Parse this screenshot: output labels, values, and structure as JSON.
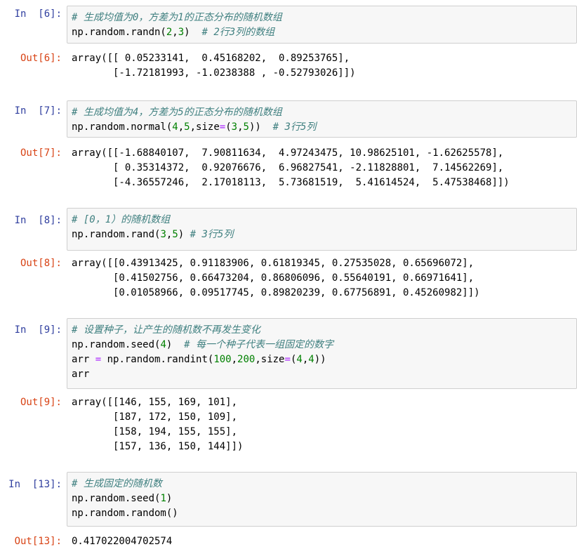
{
  "cells": [
    {
      "in_prompt": "In  [6]:",
      "code": [
        [
          {
            "t": "# 生成均值为0，方差为1的正态分布的随机数组",
            "c": "comment"
          }
        ],
        [
          {
            "t": "np.random.randn(",
            "c": ""
          },
          {
            "t": "2",
            "c": "num"
          },
          {
            "t": ",",
            "c": ""
          },
          {
            "t": "3",
            "c": "num"
          },
          {
            "t": ")  ",
            "c": ""
          },
          {
            "t": "# 2行3列的数组",
            "c": "comment"
          }
        ]
      ],
      "out_prompt": "Out[6]:",
      "output": [
        "array([[ 0.05233141,  0.45168202,  0.89253765],",
        "       [-1.72181993, -1.0238388 , -0.52793026]])"
      ]
    },
    {
      "in_prompt": "In  [7]:",
      "code": [
        [
          {
            "t": "# 生成均值为4，方差为5的正态分布的随机数组",
            "c": "comment"
          }
        ],
        [
          {
            "t": "np.random.normal(",
            "c": ""
          },
          {
            "t": "4",
            "c": "num"
          },
          {
            "t": ",",
            "c": ""
          },
          {
            "t": "5",
            "c": "num"
          },
          {
            "t": ",size",
            "c": ""
          },
          {
            "t": "=",
            "c": "op"
          },
          {
            "t": "(",
            "c": ""
          },
          {
            "t": "3",
            "c": "num"
          },
          {
            "t": ",",
            "c": ""
          },
          {
            "t": "5",
            "c": "num"
          },
          {
            "t": "))  ",
            "c": ""
          },
          {
            "t": "# 3行5列",
            "c": "comment"
          }
        ]
      ],
      "out_prompt": "Out[7]:",
      "output": [
        "array([[-1.68840107,  7.90811634,  4.97243475, 10.98625101, -1.62625578],",
        "       [ 0.35314372,  0.92076676,  6.96827541, -2.11828801,  7.14562269],",
        "       [-4.36557246,  2.17018113,  5.73681519,  5.41614524,  5.47538468]])"
      ]
    },
    {
      "in_prompt": "In  [8]:",
      "code": [
        [
          {
            "t": "# [0，1）的随机数组",
            "c": "comment"
          }
        ],
        [
          {
            "t": "np.random.rand(",
            "c": ""
          },
          {
            "t": "3",
            "c": "num"
          },
          {
            "t": ",",
            "c": ""
          },
          {
            "t": "5",
            "c": "num"
          },
          {
            "t": ") ",
            "c": ""
          },
          {
            "t": "# 3行5列",
            "c": "comment"
          }
        ]
      ],
      "out_prompt": "Out[8]:",
      "output": [
        "array([[0.43913425, 0.91183906, 0.61819345, 0.27535028, 0.65696072],",
        "       [0.41502756, 0.66473204, 0.86806096, 0.55640191, 0.66971641],",
        "       [0.01058966, 0.09517745, 0.89820239, 0.67756891, 0.45260982]])"
      ]
    },
    {
      "in_prompt": "In  [9]:",
      "code": [
        [
          {
            "t": "# 设置种子，让产生的随机数不再发生变化",
            "c": "comment"
          }
        ],
        [
          {
            "t": "np.random.seed(",
            "c": ""
          },
          {
            "t": "4",
            "c": "num"
          },
          {
            "t": ")  ",
            "c": ""
          },
          {
            "t": "# 每一个种子代表一组固定的数字",
            "c": "comment"
          }
        ],
        [
          {
            "t": "arr ",
            "c": ""
          },
          {
            "t": "=",
            "c": "op"
          },
          {
            "t": " np.random.randint(",
            "c": ""
          },
          {
            "t": "100",
            "c": "num"
          },
          {
            "t": ",",
            "c": ""
          },
          {
            "t": "200",
            "c": "num"
          },
          {
            "t": ",size",
            "c": ""
          },
          {
            "t": "=",
            "c": "op"
          },
          {
            "t": "(",
            "c": ""
          },
          {
            "t": "4",
            "c": "num"
          },
          {
            "t": ",",
            "c": ""
          },
          {
            "t": "4",
            "c": "num"
          },
          {
            "t": "))",
            "c": ""
          }
        ],
        [
          {
            "t": "arr",
            "c": ""
          }
        ]
      ],
      "out_prompt": "Out[9]:",
      "output": [
        "array([[146, 155, 169, 101],",
        "       [187, 172, 150, 109],",
        "       [158, 194, 155, 155],",
        "       [157, 136, 150, 144]])"
      ]
    },
    {
      "in_prompt": "In  [13]:",
      "code": [
        [
          {
            "t": "# 生成固定的随机数",
            "c": "comment"
          }
        ],
        [
          {
            "t": "np.random.seed(",
            "c": ""
          },
          {
            "t": "1",
            "c": "num"
          },
          {
            "t": ")",
            "c": ""
          }
        ],
        [
          {
            "t": "np.random.random()",
            "c": ""
          }
        ]
      ],
      "out_prompt": "Out[13]:",
      "output": [
        "0.417022004702574"
      ]
    }
  ]
}
